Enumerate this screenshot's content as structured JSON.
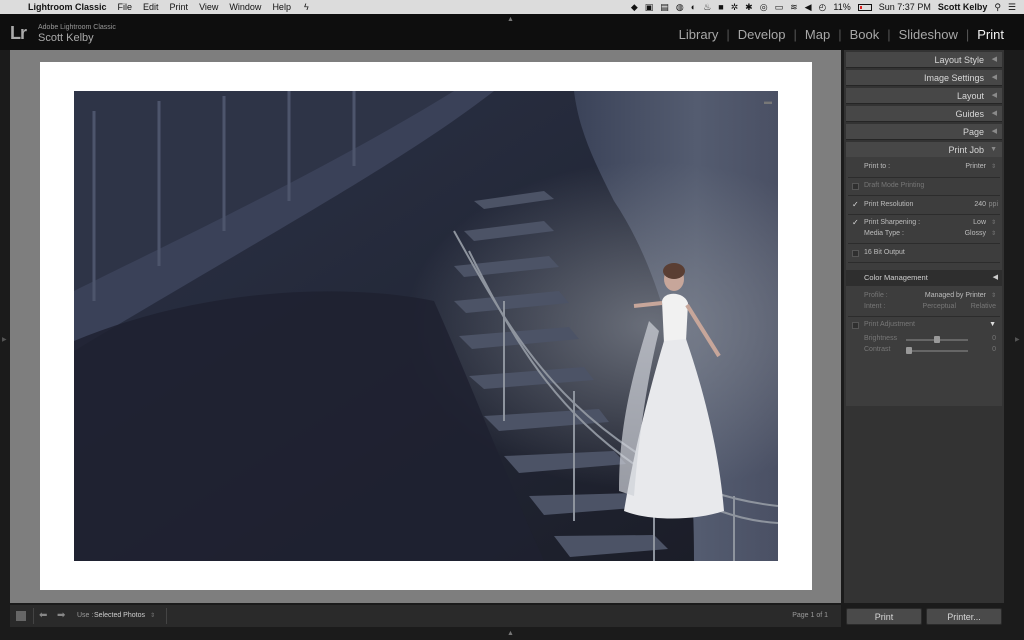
{
  "menubar": {
    "app_name": "Lightroom Classic",
    "items": [
      "File",
      "Edit",
      "Print",
      "View",
      "Window",
      "Help"
    ],
    "battery": "11%",
    "clock": "Sun 7:37 PM",
    "user": "Scott Kelby"
  },
  "identity": {
    "logo": "Lr",
    "product": "Adobe Lightroom Classic",
    "user": "Scott Kelby"
  },
  "modules": [
    {
      "label": "Library",
      "active": false
    },
    {
      "label": "Develop",
      "active": false
    },
    {
      "label": "Map",
      "active": false
    },
    {
      "label": "Book",
      "active": false
    },
    {
      "label": "Slideshow",
      "active": false
    },
    {
      "label": "Print",
      "active": true
    }
  ],
  "panels": {
    "layout_style": "Layout Style",
    "image_settings": "Image Settings",
    "layout": "Layout",
    "guides": "Guides",
    "page": "Page",
    "print_job": "Print Job"
  },
  "print_job": {
    "print_to_label": "Print to :",
    "print_to_value": "Printer",
    "draft_mode": "Draft Mode Printing",
    "resolution_label": "Print Resolution",
    "resolution_value": "240",
    "resolution_unit": "ppi",
    "sharpening_label": "Print Sharpening :",
    "sharpening_value": "Low",
    "media_label": "Media Type :",
    "media_value": "Glossy",
    "bit16": "16 Bit Output",
    "color_mgmt": "Color Management",
    "profile_label": "Profile :",
    "profile_value": "Managed by Printer",
    "intent_label": "Intent :",
    "intent_perceptual": "Perceptual",
    "intent_relative": "Relative",
    "adjustment": "Print Adjustment",
    "brightness_label": "Brightness",
    "brightness_value": "0",
    "contrast_label": "Contrast",
    "contrast_value": "0"
  },
  "toolbar": {
    "use_label": "Use :",
    "use_value": "Selected Photos",
    "page_info": "Page 1 of 1"
  },
  "buttons": {
    "print": "Print",
    "printer": "Printer..."
  }
}
